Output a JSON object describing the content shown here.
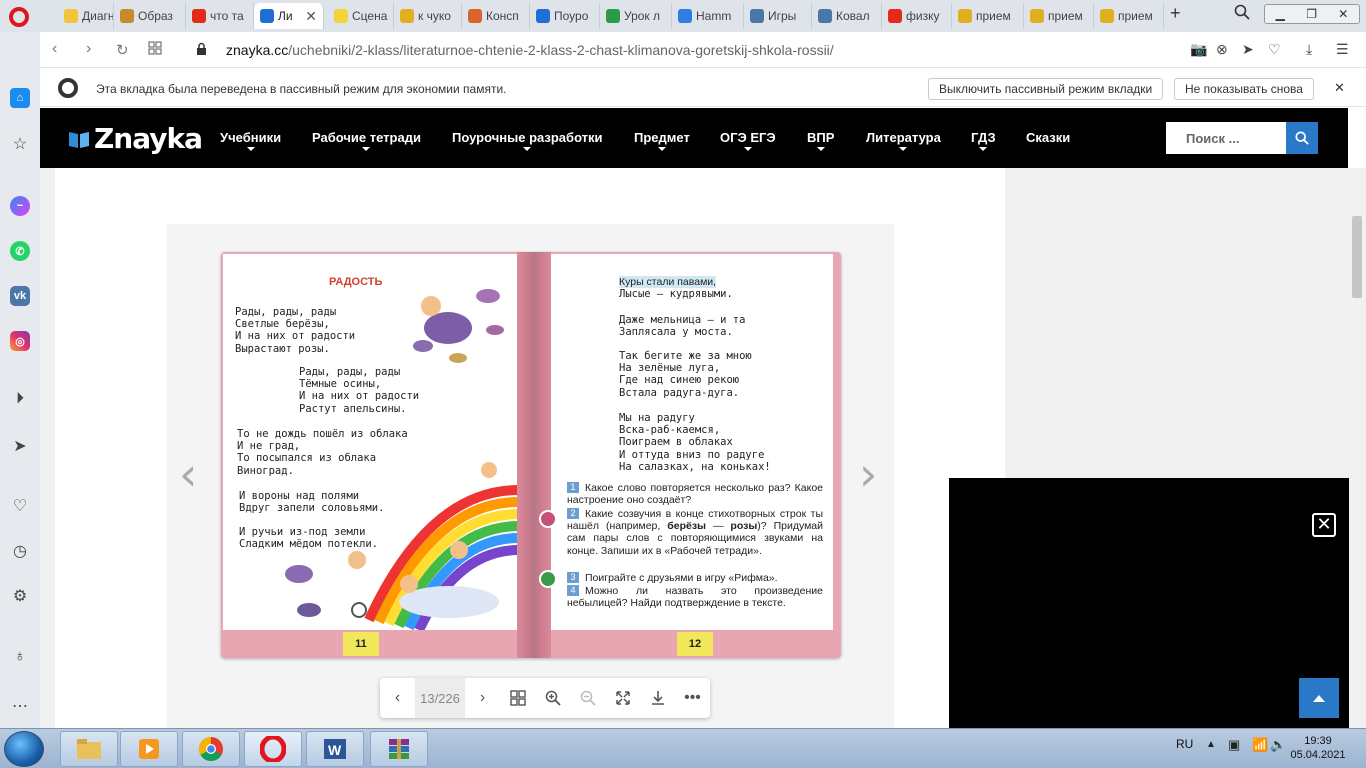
{
  "tabs": [
    {
      "label": "Диагн",
      "color": "#f3c33a"
    },
    {
      "label": "Образ",
      "color": "#c98a2e"
    },
    {
      "label": "что та",
      "color": "#e52a1a"
    },
    {
      "label": "Ли",
      "color": "#1d6fd6",
      "active": true
    },
    {
      "label": "Сцена",
      "color": "#f2d33a"
    },
    {
      "label": "к чуко",
      "color": "#e0b020"
    },
    {
      "label": "Консп",
      "color": "#d9652c"
    },
    {
      "label": "Поуро",
      "color": "#1d6fd6"
    },
    {
      "label": "Урок л",
      "color": "#2a9a4c"
    },
    {
      "label": "Hamm",
      "color": "#2f7ee6"
    },
    {
      "label": "Игры",
      "color": "#4a76a8"
    },
    {
      "label": "Ковал",
      "color": "#4a76a8"
    },
    {
      "label": "физку",
      "color": "#e52a1a"
    },
    {
      "label": "прием",
      "color": "#e0b020"
    },
    {
      "label": "прием",
      "color": "#e0b020"
    },
    {
      "label": "прием",
      "color": "#e0b020"
    }
  ],
  "address": {
    "domain": "znayka.cc",
    "path": "/uchebniki/2-klass/literaturnoe-chtenie-2-klass-2-chast-klimanova-goretskij-shkola-rossii/"
  },
  "infobar": {
    "message": "Эта вкладка была переведена в пассивный режим для экономии памяти.",
    "disable_label": "Выключить пассивный режим вкладки",
    "dont_show_label": "Не показывать снова"
  },
  "site": {
    "logo": "Znayka",
    "menu": [
      {
        "label": "Учебники",
        "dropdown": true
      },
      {
        "label": "Рабочие тетради",
        "dropdown": true
      },
      {
        "label": "Поурочные разработки",
        "dropdown": true
      },
      {
        "label": "Предмет",
        "dropdown": true
      },
      {
        "label": "ОГЭ ЕГЭ",
        "dropdown": true
      },
      {
        "label": "ВПР",
        "dropdown": true
      },
      {
        "label": "Литература",
        "dropdown": true
      },
      {
        "label": "ГДЗ",
        "dropdown": true
      },
      {
        "label": "Сказки",
        "dropdown": false
      }
    ],
    "search_placeholder": "Поиск ..."
  },
  "book": {
    "left": {
      "title": "РАДОСТЬ",
      "stanzas": [
        "Рады, рады, рады\nСветлые берёзы,\nИ на них от радости\nВырастают розы.",
        "Рады, рады, рады\nТёмные осины,\nИ на них от радости\nРастут апельсины.",
        "То не дождь пошёл из облака\nИ не град,\nТо посыпался из облака\nВиноград.",
        "И вороны над полями\nВдруг запели соловьями.",
        "И ручьи из-под земли\nСладким мёдом потекли."
      ],
      "page_number": "11"
    },
    "right": {
      "highlighted": "Куры стали павами,",
      "stanzas": [
        "Лысые — кудрявыми.",
        "Даже мельница — и та\nЗаплясала у моста.",
        "Так бегите же за мною\nНа зелёные луга,\nГде над синею рекою\nВстала радуга-дуга.",
        "Мы на радугу\nВска-раб-каемся,\nПоиграем в облаках\nИ оттуда вниз по радуге\nНа салазках, на коньках!"
      ],
      "questions": [
        {
          "n": "1",
          "text": "Какое слово повторяется несколько раз? Какое настроение оно создаёт?"
        },
        {
          "n": "2",
          "text_before": "Какие созвучия в конце стихотворных строк ты нашёл (например, ",
          "bold1": "берёзы",
          "dash": " — ",
          "bold2": "розы",
          "text_after": ")? Придумай сам пары слов с повторяющимися звуками на конце. Запиши их в «Рабочей тетради»."
        },
        {
          "n": "3",
          "text": "Поиграйте с друзьями в игру «Рифма»."
        },
        {
          "n": "4",
          "text": "Можно ли назвать это произведение небылицей? Найди подтверждение в тексте."
        }
      ],
      "page_number": "12"
    }
  },
  "viewer": {
    "page_counter": "13/226"
  },
  "taskbar": {
    "lang": "RU",
    "time": "19:39",
    "date": "05.04.2021"
  }
}
